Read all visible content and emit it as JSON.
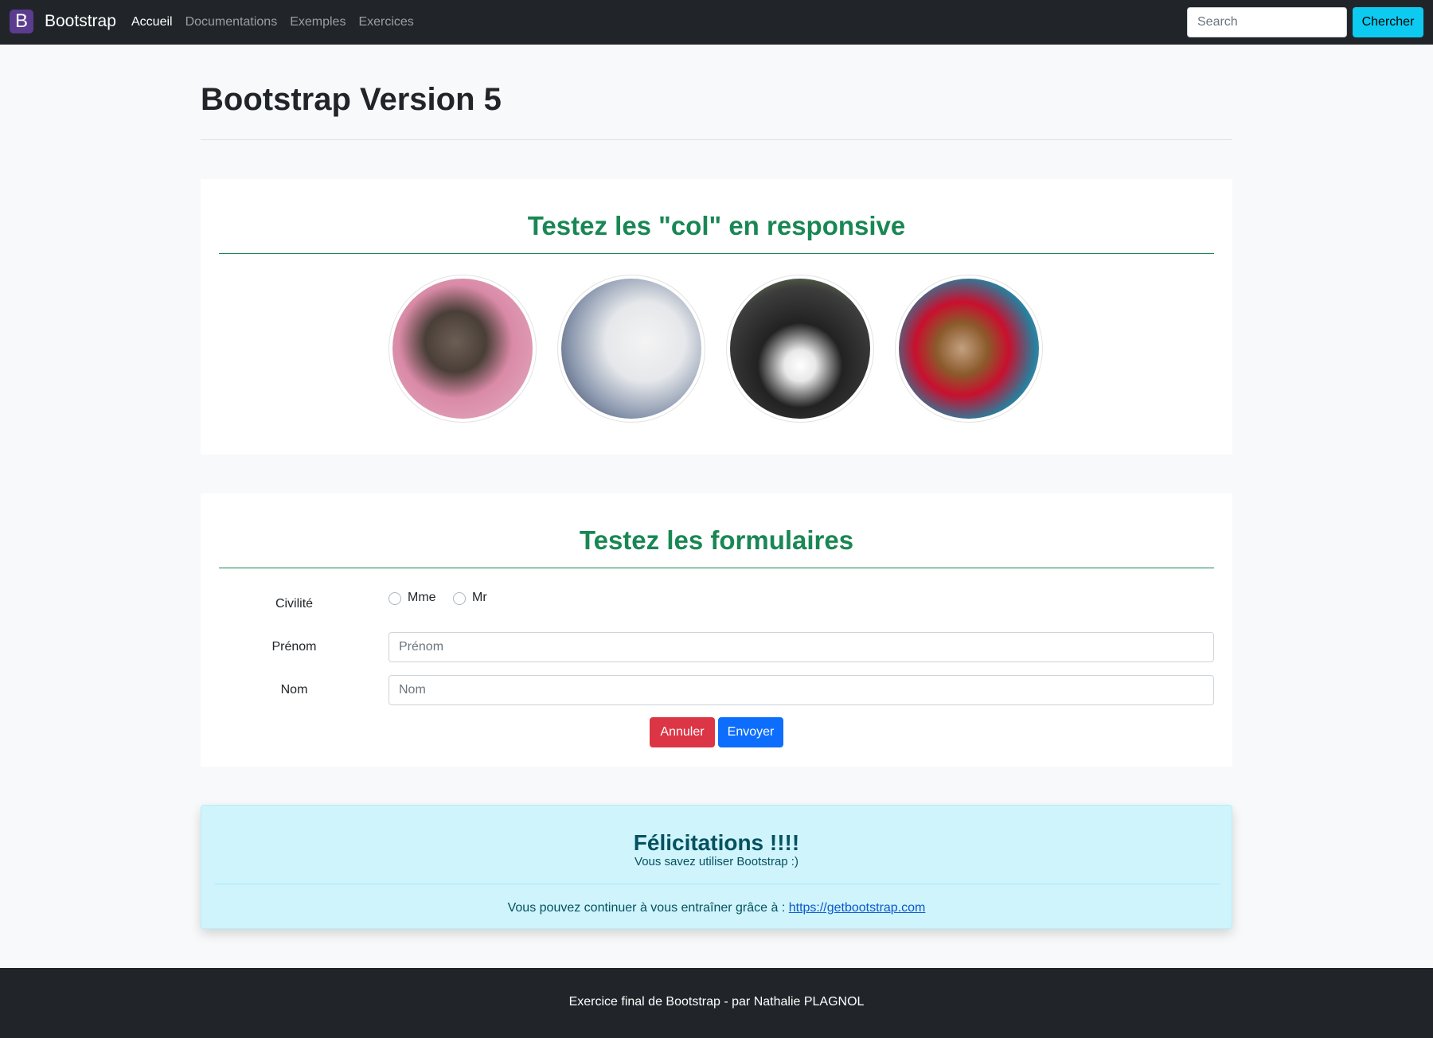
{
  "navbar": {
    "brand_letter": "B",
    "brand_name": "Bootstrap",
    "links": [
      {
        "label": "Accueil",
        "active": true
      },
      {
        "label": "Documentations",
        "active": false
      },
      {
        "label": "Exemples",
        "active": false
      },
      {
        "label": "Exercices",
        "active": false
      }
    ],
    "search_placeholder": "Search",
    "search_button": "Chercher"
  },
  "page_title": "Bootstrap Version 5",
  "section_cols": {
    "title": "Testez les \"col\" en responsive",
    "images": [
      "kitten-tabby-image",
      "kitten-white-image",
      "kitten-black-white-image",
      "kitten-calico-image"
    ]
  },
  "section_form": {
    "title": "Testez les formulaires",
    "civility_label": "Civilité",
    "civility_options": [
      "Mme",
      "Mr"
    ],
    "firstname_label": "Prénom",
    "firstname_placeholder": "Prénom",
    "lastname_label": "Nom",
    "lastname_placeholder": "Nom",
    "cancel_button": "Annuler",
    "send_button": "Envoyer"
  },
  "alert": {
    "title": "Félicitations !!!!",
    "subtitle": "Vous savez utiliser Bootstrap :)",
    "footer_text": "Vous pouvez continuer à vous entraîner grâce à : ",
    "link_text": "https://getbootstrap.com"
  },
  "footer": {
    "text": "Exercice final de Bootstrap - par Nathalie PLAGNOL"
  },
  "colors": {
    "navbar_bg": "#212529",
    "section_title": "#198754",
    "danger": "#dc3545",
    "primary": "#0d6efd",
    "info": "#0dcaf0",
    "alert_bg": "#cff4fc"
  }
}
